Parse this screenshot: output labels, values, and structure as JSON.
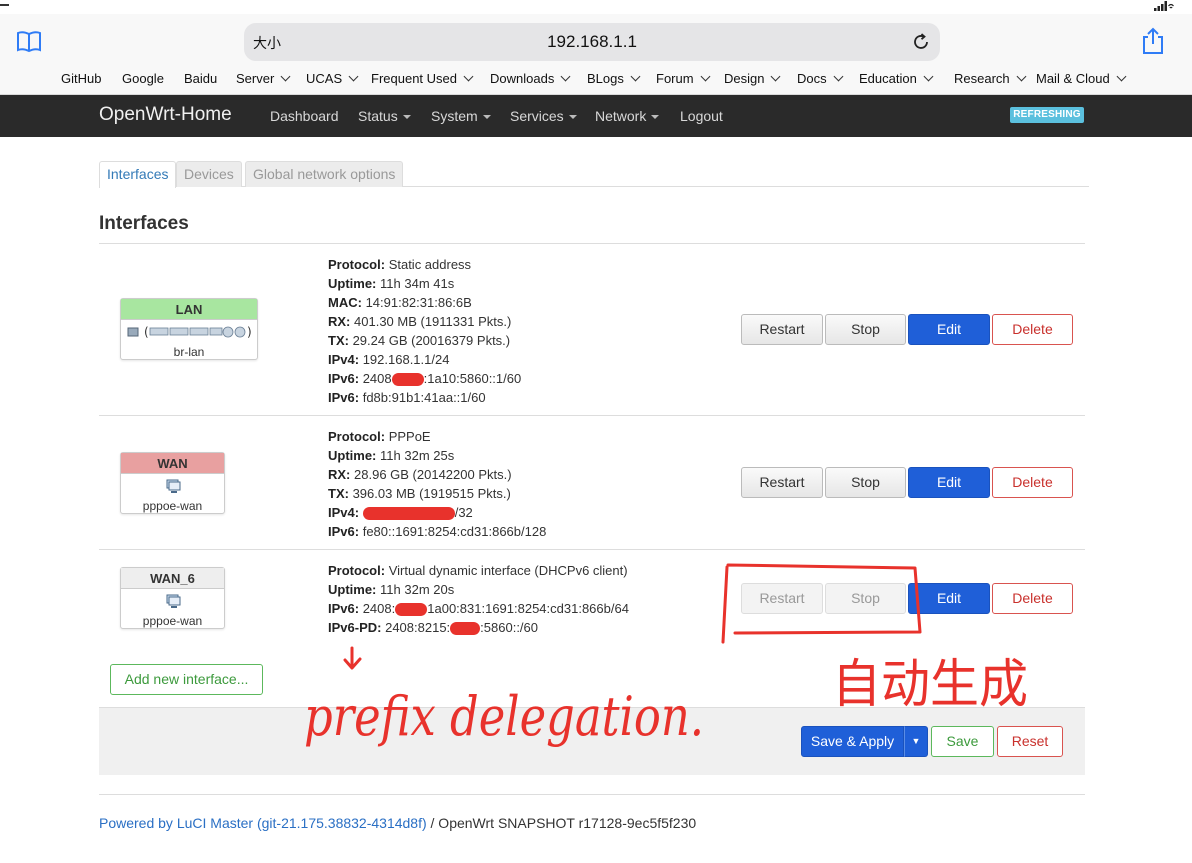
{
  "browser": {
    "aa_label": "大小",
    "url": "192.168.1.1",
    "bookmarks": [
      "GitHub",
      "Google",
      "Baidu",
      "Server",
      "UCAS",
      "Frequent Used",
      "Downloads",
      "BLogs",
      "Forum",
      "Design",
      "Docs",
      "Education",
      "Research",
      "Mail & Cloud"
    ],
    "icons": [
      "book-icon",
      "reload-icon",
      "share-icon",
      "signal-icon",
      "wifi-icon"
    ]
  },
  "header": {
    "brand": "OpenWrt-Home",
    "nav": [
      "Dashboard",
      "Status",
      "System",
      "Services",
      "Network",
      "Logout"
    ],
    "refresh_badge": "REFRESHING"
  },
  "tabs": [
    "Interfaces",
    "Devices",
    "Global network options"
  ],
  "section_title": "Interfaces",
  "interfaces": [
    {
      "name": "LAN",
      "device": "br-lan",
      "color": "#a8e6a0",
      "lines": [
        {
          "k": "Protocol:",
          "v": "Static address"
        },
        {
          "k": "Uptime:",
          "v": "11h 34m 41s"
        },
        {
          "k": "MAC:",
          "v": "14:91:82:31:86:6B"
        },
        {
          "k": "RX:",
          "v": "401.30 MB (1911331 Pkts.)"
        },
        {
          "k": "TX:",
          "v": "29.24 GB (20016379 Pkts.)"
        },
        {
          "k": "IPv4:",
          "v": "192.168.1.1/24"
        },
        {
          "k": "IPv6:",
          "v_pre": "2408",
          "v_post": ":1a10:5860::1/60"
        },
        {
          "k": "IPv6:",
          "v": "fd8b:91b1:41aa::1/60"
        }
      ]
    },
    {
      "name": "WAN",
      "device": "pppoe-wan",
      "color": "#e8a0a0",
      "lines": [
        {
          "k": "Protocol:",
          "v": "PPPoE"
        },
        {
          "k": "Uptime:",
          "v": "11h 32m 25s"
        },
        {
          "k": "RX:",
          "v": "28.96 GB (20142200 Pkts.)"
        },
        {
          "k": "TX:",
          "v": "396.03 MB (1919515 Pkts.)"
        },
        {
          "k": "IPv4:",
          "v_pre": "",
          "v_post": "/32"
        },
        {
          "k": "IPv6:",
          "v": "fe80::1691:8254:cd31:866b/128"
        }
      ]
    },
    {
      "name": "WAN_6",
      "device": "pppoe-wan",
      "color": "#eeeeee",
      "lines": [
        {
          "k": "Protocol:",
          "v": "Virtual dynamic interface (DHCPv6 client)"
        },
        {
          "k": "Uptime:",
          "v": "11h 32m 20s"
        },
        {
          "k": "IPv6:",
          "v_pre": "2408:",
          "v_post": "1a00:831:1691:8254:cd31:866b/64"
        },
        {
          "k": "IPv6-PD:",
          "v_pre": "2408:8215:",
          "v_post": ":5860::/60"
        }
      ]
    }
  ],
  "buttons": {
    "restart": "Restart",
    "stop": "Stop",
    "edit": "Edit",
    "delete": "Delete",
    "add_interface": "Add new interface...",
    "save_apply": "Save & Apply",
    "save": "Save",
    "reset": "Reset"
  },
  "footer": {
    "powered_link": "Powered by LuCI Master (git-21.175.38832-4314d8f)",
    "powered_rest": " / OpenWrt SNAPSHOT r17128-9ec5f5f230"
  },
  "annotations": {
    "handwritten_en": "prefix delegation.",
    "handwritten_zh": "自动生成",
    "ink_color": "#e8322c"
  }
}
